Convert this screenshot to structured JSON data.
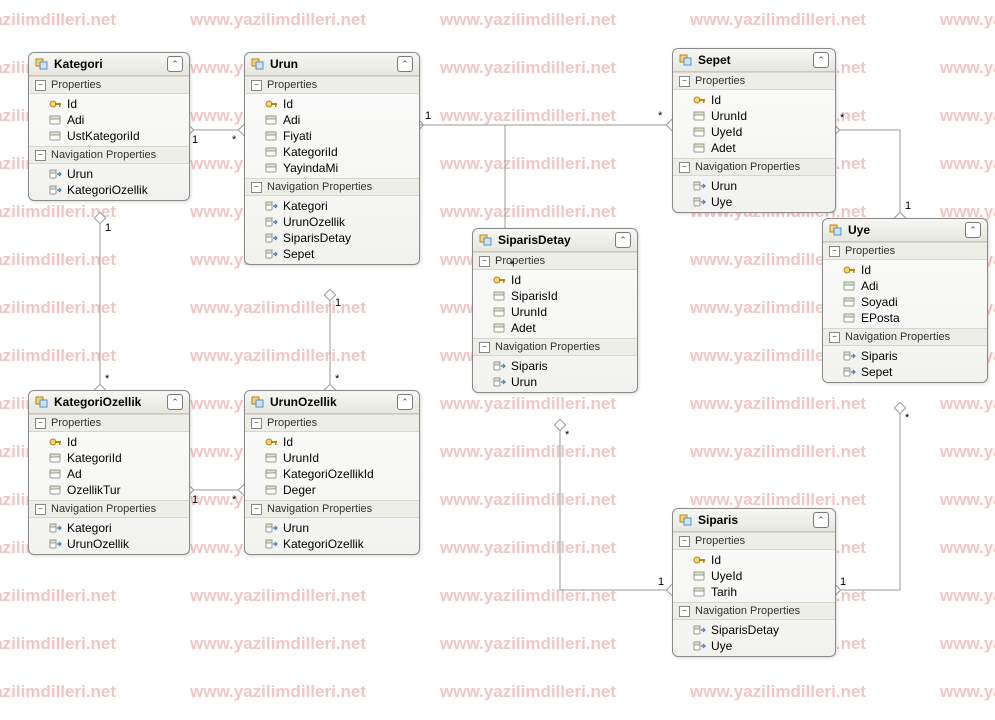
{
  "watermark_text": "www.yazilimdilleri.net",
  "section_labels": {
    "properties": "Properties",
    "nav": "Navigation Properties"
  },
  "entities": {
    "kategori": {
      "title": "Kategori",
      "properties": [
        "Id",
        "Adi",
        "UstKategoriId"
      ],
      "nav": [
        "Urun",
        "KategoriOzellik"
      ]
    },
    "urun": {
      "title": "Urun",
      "properties": [
        "Id",
        "Adi",
        "Fiyati",
        "KategoriId",
        "YayindaMi"
      ],
      "nav": [
        "Kategori",
        "UrunOzellik",
        "SiparisDetay",
        "Sepet"
      ]
    },
    "sepet": {
      "title": "Sepet",
      "properties": [
        "Id",
        "UrunId",
        "UyeId",
        "Adet"
      ],
      "nav": [
        "Urun",
        "Uye"
      ]
    },
    "uye": {
      "title": "Uye",
      "properties": [
        "Id",
        "Adi",
        "Soyadi",
        "EPosta"
      ],
      "nav": [
        "Siparis",
        "Sepet"
      ]
    },
    "siparisdetay": {
      "title": "SiparisDetay",
      "properties": [
        "Id",
        "SiparisId",
        "UrunId",
        "Adet"
      ],
      "nav": [
        "Siparis",
        "Urun"
      ]
    },
    "kategoriozellik": {
      "title": "KategoriOzellik",
      "properties": [
        "Id",
        "KategoriId",
        "Ad",
        "OzellikTur"
      ],
      "nav": [
        "Kategori",
        "UrunOzellik"
      ]
    },
    "urunozellik": {
      "title": "UrunOzellik",
      "properties": [
        "Id",
        "UrunId",
        "KategoriOzellikId",
        "Deger"
      ],
      "nav": [
        "Urun",
        "KategoriOzellik"
      ]
    },
    "siparis": {
      "title": "Siparis",
      "properties": [
        "Id",
        "UyeId",
        "Tarih"
      ],
      "nav": [
        "SiparisDetay",
        "Uye"
      ]
    }
  },
  "relationships": [
    {
      "from": "Kategori",
      "from_card": "1",
      "to": "Urun",
      "to_card": "*"
    },
    {
      "from": "Kategori",
      "from_card": "1",
      "to": "KategoriOzellik",
      "to_card": "*"
    },
    {
      "from": "KategoriOzellik",
      "from_card": "1",
      "to": "UrunOzellik",
      "to_card": "*"
    },
    {
      "from": "Urun",
      "from_card": "1",
      "to": "UrunOzellik",
      "to_card": "*"
    },
    {
      "from": "Urun",
      "from_card": "1",
      "to": "SiparisDetay",
      "to_card": "*"
    },
    {
      "from": "Urun",
      "from_card": "1",
      "to": "Sepet",
      "to_card": "*"
    },
    {
      "from": "Siparis",
      "from_card": "1",
      "to": "SiparisDetay",
      "to_card": "*"
    },
    {
      "from": "Uye",
      "from_card": "1",
      "to": "Sepet",
      "to_card": "*"
    },
    {
      "from": "Uye",
      "from_card": "1",
      "to": "Siparis",
      "to_card": "*"
    }
  ],
  "cardinality_labels": {
    "kat_urun_1": "1",
    "kat_urun_s": "*",
    "kat_ko_1": "1",
    "kat_ko_s": "*",
    "ko_uo_1": "1",
    "ko_uo_s": "*",
    "urun_uo_1": "1",
    "urun_uo_s": "*",
    "urun_sd_1": "1",
    "urun_sd_s": "*",
    "urun_sepet_1": "1",
    "urun_sepet_s": "*",
    "sip_sd_1": "1",
    "sip_sd_s": "*",
    "uye_sepet_1": "1",
    "uye_sepet_s": "*",
    "uye_sip_1": "1",
    "uye_sip_s": "*"
  }
}
